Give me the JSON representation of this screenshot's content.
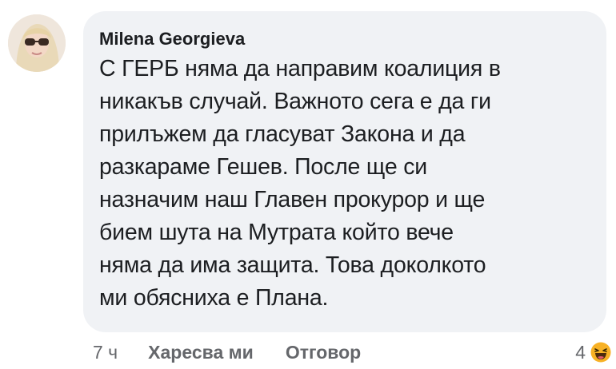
{
  "comment": {
    "author": "Milena Georgieva",
    "text": "С ГЕРБ няма да направим коалиция в\nникакъв случай. Важното сега е да ги\nприлъжем да гласуват Закона и да\nразкараме Гешев. После ще си\nназначим наш Главен прокурор и ще\nбием шута на Мутрата който вече\nняма да има защита. Това доколкото\nми обясниха е Плана."
  },
  "actions": {
    "time": "7 ч",
    "like_label": "Харесва ми",
    "reply_label": "Отговор"
  },
  "reactions": {
    "count": "4",
    "icon": "haha-reaction-icon"
  },
  "colors": {
    "bubble": "#f0f2f5",
    "text": "#1c1e21",
    "meta": "#65676b",
    "haha": "#f7b125"
  }
}
